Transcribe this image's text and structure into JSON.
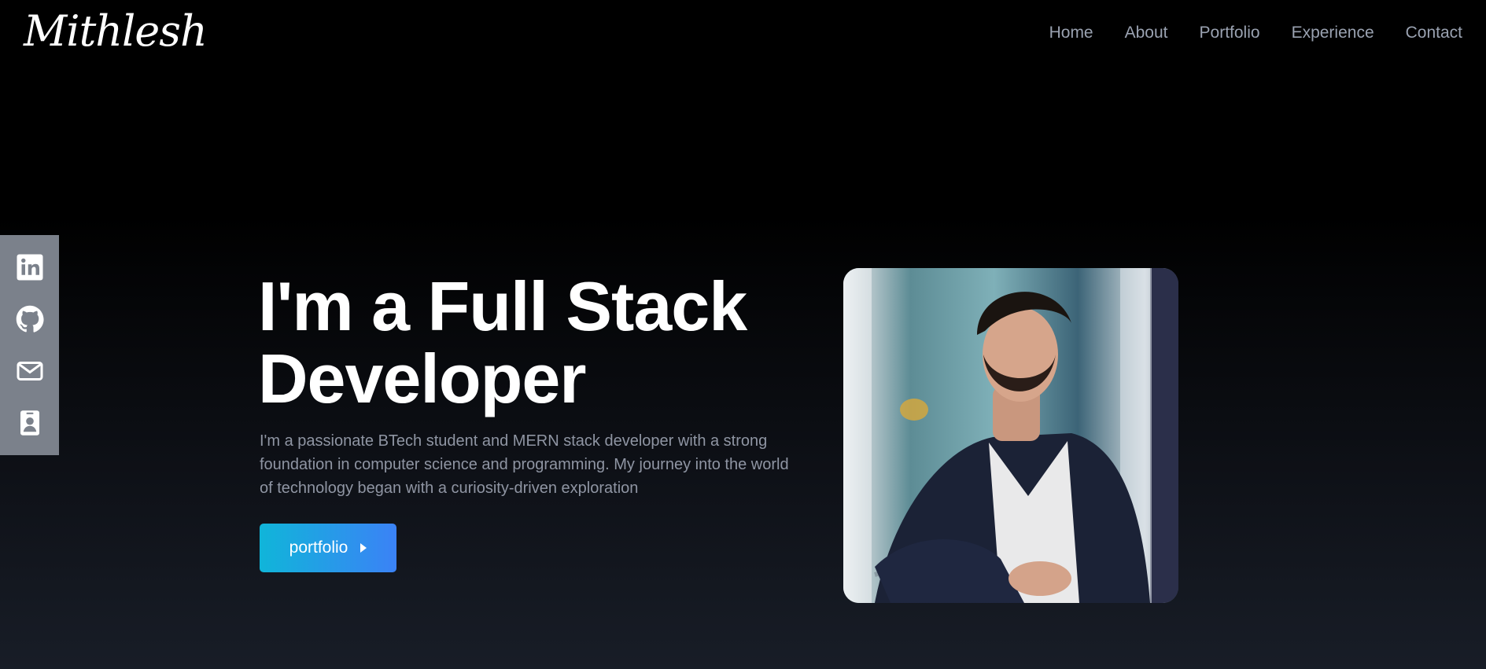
{
  "header": {
    "logo": "Mithlesh",
    "nav": [
      "Home",
      "About",
      "Portfolio",
      "Experience",
      "Contact"
    ]
  },
  "social": {
    "items": [
      {
        "icon": "linkedin-icon"
      },
      {
        "icon": "github-icon"
      },
      {
        "icon": "mail-icon"
      },
      {
        "icon": "resume-icon"
      }
    ]
  },
  "hero": {
    "title_line1": "I'm a Full Stack",
    "title_line2": "Developer",
    "description": "I'm a passionate BTech student and MERN stack developer with a strong foundation in computer science and programming. My journey into the world of technology began with a curiosity-driven exploration",
    "cta_label": "portfolio",
    "cta_icon": "caret-right-icon"
  },
  "colors": {
    "background": "#000000",
    "nav_text": "#9aa2b1",
    "sidebar": "#7b818b",
    "cta_gradient_start": "#10b5d9",
    "cta_gradient_end": "#3b82f6"
  }
}
